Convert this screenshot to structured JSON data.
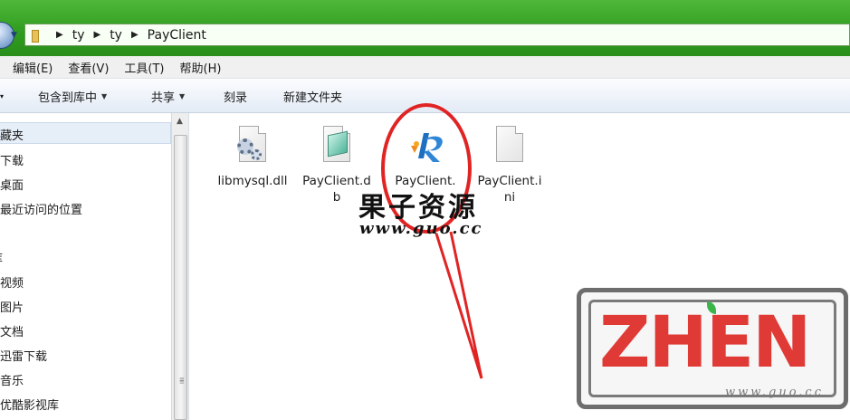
{
  "address_bar": {
    "crumbs": [
      "ty",
      "ty",
      "PayClient"
    ]
  },
  "menu": {
    "items": [
      "编辑(E)",
      "查看(V)",
      "工具(T)",
      "帮助(H)"
    ]
  },
  "commandbar": {
    "include_library": "包含到库中",
    "share": "共享",
    "burn": "刻录",
    "new_folder": "新建文件夹"
  },
  "sidebar": {
    "favorites": "收藏夹",
    "items": [
      "下载",
      "桌面",
      "最近访问的位置",
      "库",
      "视频",
      "图片",
      "文档",
      "迅雷下载",
      "音乐",
      "优酷影视库"
    ]
  },
  "files": [
    {
      "name": "libmysql.dll",
      "icon": "dll-gear-icon"
    },
    {
      "name": "PayClient.db",
      "icon": "db-file-icon"
    },
    {
      "name": "PayClient.",
      "icon": "payclient-app-icon"
    },
    {
      "name": "PayClient.ini",
      "icon": "ini-file-icon"
    }
  ],
  "watermark": {
    "cn": "果子资源",
    "url": "www.guo.cc",
    "stamp": "ZHEN",
    "stamp_sub": "www.guo.cc"
  },
  "colors": {
    "titlebar_green": "#2e9b1e",
    "annotation_red": "#e02424",
    "stamp_red": "#e03a37"
  }
}
